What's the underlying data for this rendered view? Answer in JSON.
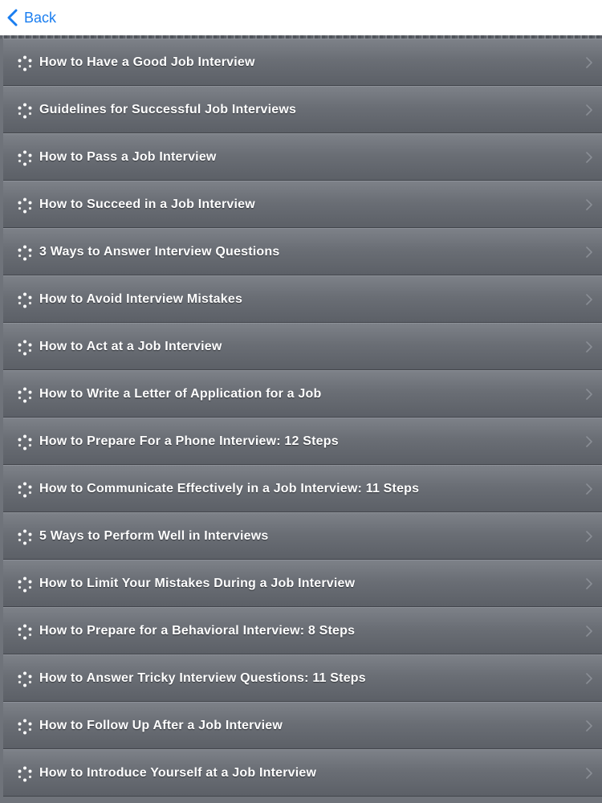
{
  "nav": {
    "back_label": "Back",
    "accent": "#1a7ef0"
  },
  "icons": {
    "row": "sparkle-dots-icon",
    "disclosure": "chevron-right-icon",
    "back": "chevron-left-icon"
  },
  "items": [
    "How to Have a Good Job Interview",
    "Guidelines for Successful Job Interviews",
    "How to Pass a Job Interview",
    "How to Succeed in a Job Interview",
    "3 Ways to Answer Interview Questions",
    "How to Avoid Interview Mistakes",
    "How to Act at a Job Interview",
    "How to Write a Letter of Application for a Job",
    "How to Prepare For a Phone Interview: 12 Steps",
    "How to Communicate Effectively in a Job Interview: 11 Steps",
    "5 Ways to Perform Well in Interviews",
    "How to Limit Your Mistakes During a Job Interview",
    "How to Prepare for a Behavioral Interview: 8 Steps",
    "How to Answer Tricky Interview Questions: 11 Steps",
    "How to Follow Up After a Job Interview",
    "How to Introduce Yourself at a Job Interview"
  ]
}
